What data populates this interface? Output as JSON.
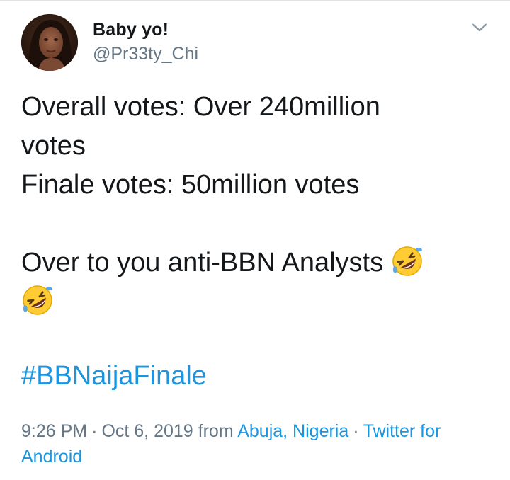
{
  "user": {
    "display_name": "Baby yo!",
    "handle": "@Pr33ty_Chi",
    "avatar_icon": "profile-photo"
  },
  "menu": {
    "icon": "chevron-down-icon"
  },
  "tweet": {
    "lines": [
      "Overall votes: Over 240million",
      "votes",
      "Finale votes: 50million votes",
      "",
      "Over to you anti-BBN Analysts"
    ],
    "emoji": "rolling-on-the-floor-laughing-emoji",
    "hashtag": "#BBNaijaFinale"
  },
  "meta": {
    "time": "9:26 PM",
    "date": "Oct 6, 2019",
    "from_label": "from",
    "location": "Abuja, Nigeria",
    "separator": "·",
    "source": "Twitter for Android"
  },
  "colors": {
    "link": "#1b95e0",
    "text": "#14171a",
    "secondary": "#657786"
  }
}
